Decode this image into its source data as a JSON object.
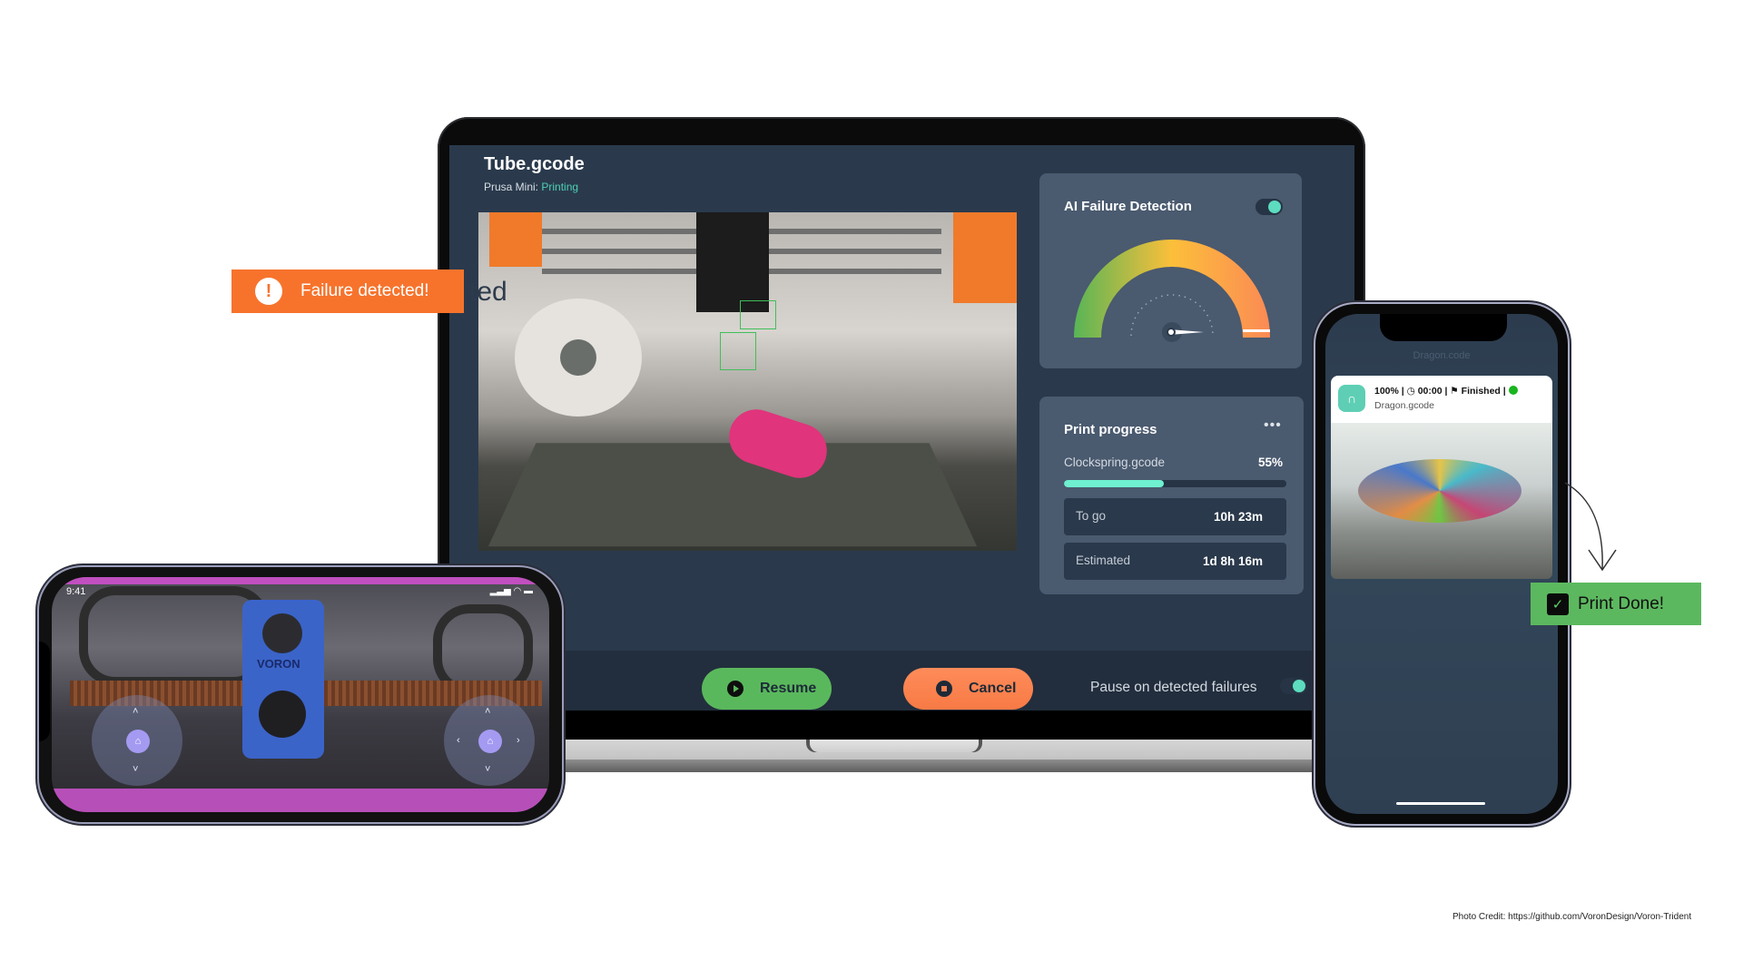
{
  "laptop": {
    "file_title": "Tube.gcode",
    "printer_name": "Prusa Mini:",
    "printer_state": "Printing",
    "ghost_text": "ted",
    "ai_panel": {
      "title": "AI Failure Detection",
      "toggle_on": true,
      "gauge_icon": "speedometer-needle-icon"
    },
    "print_progress": {
      "title": "Print progress",
      "menu_icon": "more-dots-icon",
      "menu_glyph": "•••",
      "file": "Clockspring.gcode",
      "percent_label": "55%",
      "progress_fraction": 0.45,
      "rows": [
        {
          "label": "To go",
          "value": "10h 23m"
        },
        {
          "label": "Estimated",
          "value": "1d 8h 16m"
        }
      ]
    },
    "bottom_bar": {
      "resume_label": "Resume",
      "cancel_label": "Cancel",
      "pause_label": "Pause on detected failures",
      "pause_toggle_on": true
    }
  },
  "failure_banner": {
    "icon_glyph": "!",
    "text": "Failure detected!"
  },
  "left_phone": {
    "time": "9:41",
    "status_icons": "▂▃▅ ◠ ▬",
    "brand_text": "VORON",
    "home_glyph": "⌂",
    "arrow_up": "˄",
    "arrow_down": "˅",
    "arrow_left": "‹",
    "arrow_right": "›"
  },
  "right_phone": {
    "header_title": "Dragon.code",
    "notification": {
      "app_glyph": "∩",
      "line": "100%   | ◷ 00:00 | ⚑ Finished  | ",
      "file": "Dragon.gcode"
    }
  },
  "print_done": {
    "check_glyph": "✓",
    "text": "Print Done!"
  },
  "photo_credit": "Photo Credit: https://github.com/VoronDesign/Voron-Trident",
  "colors": {
    "screen_bg": "#2a3a4c",
    "panel_bg": "#4a5a6f",
    "accent_teal": "#5ddcbf",
    "resume_green": "#5ab85c",
    "cancel_orange": "#f98250",
    "failure_orange": "#f7732c",
    "done_green": "#5cb85f"
  }
}
